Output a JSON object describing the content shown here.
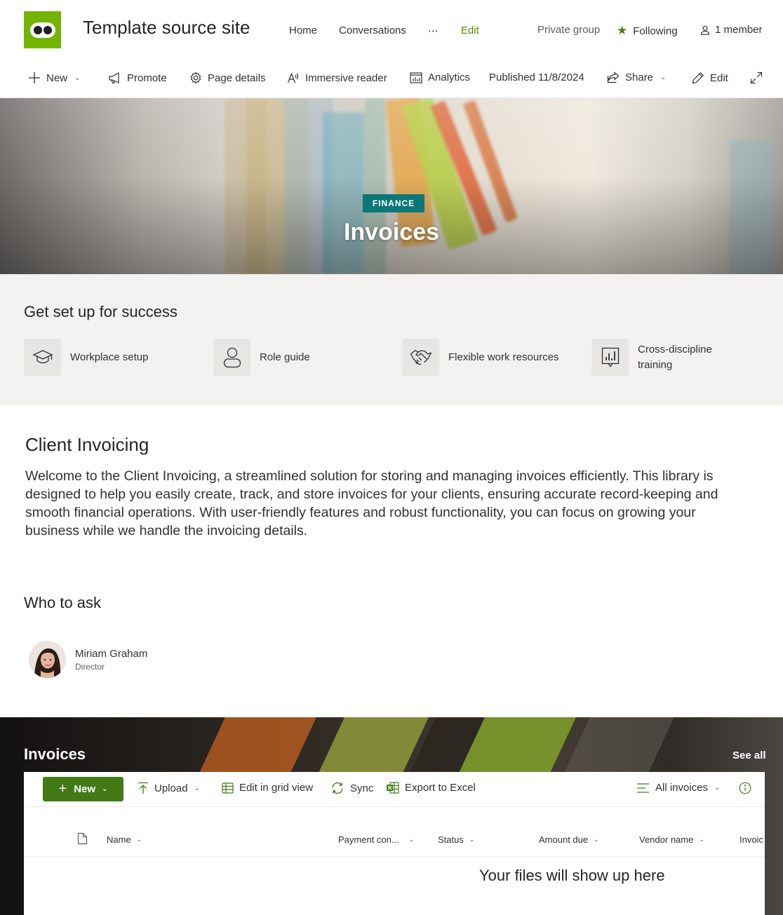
{
  "site": {
    "title": "Template source site",
    "nav": {
      "home": "Home",
      "conversations": "Conversations",
      "more": "⋯",
      "edit": "Edit"
    },
    "privacy": "Private group",
    "following": "Following",
    "members": "1 member",
    "colors": {
      "logo": "#73b400",
      "edit_link": "#5c8a00",
      "following_star": "#4b7f14"
    }
  },
  "commandbar": {
    "new": "New",
    "promote": "Promote",
    "page_details": "Page details",
    "immersive_reader": "Immersive reader",
    "analytics": "Analytics",
    "published": "Published 11/8/2024",
    "share": "Share",
    "edit": "Edit"
  },
  "hero": {
    "tag": "FINANCE",
    "title": "Invoices",
    "tag_color": "#0c7778"
  },
  "setup": {
    "title": "Get set up for success",
    "items": [
      {
        "label": "Workplace setup",
        "icon": "graduation-cap-icon"
      },
      {
        "label": "Role guide",
        "icon": "person-icon"
      },
      {
        "label": "Flexible work resources",
        "icon": "handshake-icon"
      },
      {
        "label": "Cross-discipline training",
        "icon": "chart-board-icon"
      }
    ]
  },
  "client_invoicing": {
    "title": "Client Invoicing",
    "body": "Welcome to the Client Invoicing, a streamlined solution for storing and managing invoices efficiently. This library is designed to help you easily create, track, and store invoices for your clients, ensuring accurate record-keeping and smooth financial operations. With user-friendly features and robust functionality, you can focus on growing your business while we handle the invoicing details."
  },
  "who_to_ask": {
    "title": "Who to ask",
    "person": {
      "name": "Miriam Graham",
      "role": "Director"
    }
  },
  "invoices": {
    "title": "Invoices",
    "see_all": "See all",
    "toolbar": {
      "new": "New",
      "upload": "Upload",
      "edit_grid": "Edit in grid view",
      "sync": "Sync",
      "export": "Export to Excel",
      "view": "All invoices"
    },
    "columns": [
      "Name",
      "Payment con...",
      "Status",
      "Amount due",
      "Vendor name",
      "Invoic"
    ],
    "empty_message": "Your files will show up here",
    "colors": {
      "new_button": "#427a16"
    }
  }
}
